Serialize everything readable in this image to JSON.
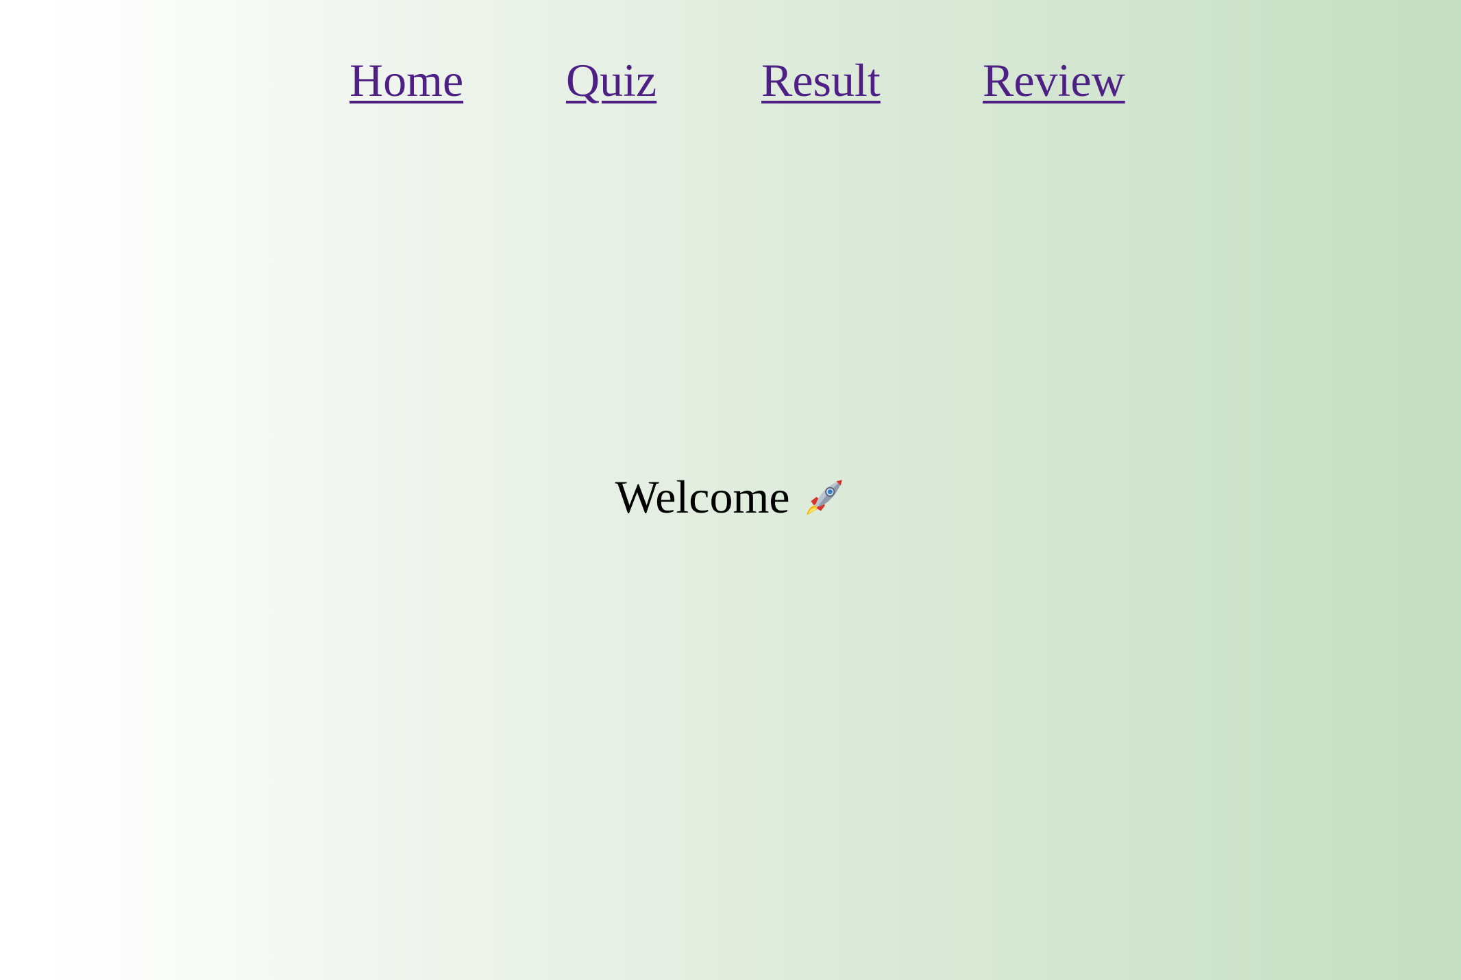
{
  "nav": {
    "items": [
      {
        "label": "Home"
      },
      {
        "label": "Quiz"
      },
      {
        "label": "Result"
      },
      {
        "label": "Review"
      }
    ],
    "link_color": "#4e1f84"
  },
  "main": {
    "welcome_text": "Welcome",
    "welcome_icon": "rocket-icon"
  },
  "colors": {
    "background_start": "#ffffff",
    "background_end": "#c5dfc2",
    "text": "#000000"
  }
}
